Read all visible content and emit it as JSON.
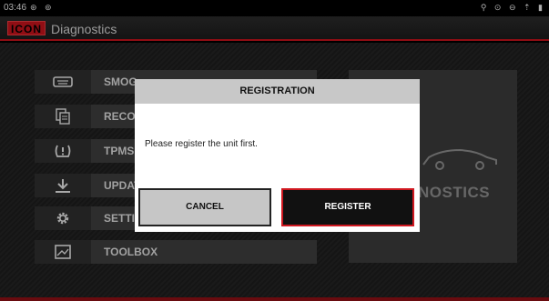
{
  "status_bar": {
    "time": "03:46",
    "left_icons": "⊛ ⊚",
    "right_icons": "⚲ ⊙ ⊖ ⇡ ▮"
  },
  "app": {
    "logo": "ICON",
    "title": "Diagnostics"
  },
  "menu": {
    "items": [
      {
        "label": "SMOG",
        "icon": "obd-connector-icon"
      },
      {
        "label": "RECO",
        "icon": "documents-icon"
      },
      {
        "label": "TPMS",
        "icon": "tpms-warning-icon"
      },
      {
        "label": "UPDAT",
        "icon": "download-icon"
      },
      {
        "label": "SETTI",
        "icon": "gear-icon"
      },
      {
        "label": "TOOLBOX",
        "icon": "toolbox-image-icon"
      }
    ]
  },
  "side_panel": {
    "text": "NOSTICS",
    "icon": "car-outline-icon"
  },
  "dialog": {
    "title": "REGISTRATION",
    "message": "Please register the unit first.",
    "cancel_label": "CANCEL",
    "register_label": "REGISTER"
  },
  "colors": {
    "accent": "#c0131b",
    "dialog_header": "#c8c8c8",
    "register_bg": "#111111"
  }
}
